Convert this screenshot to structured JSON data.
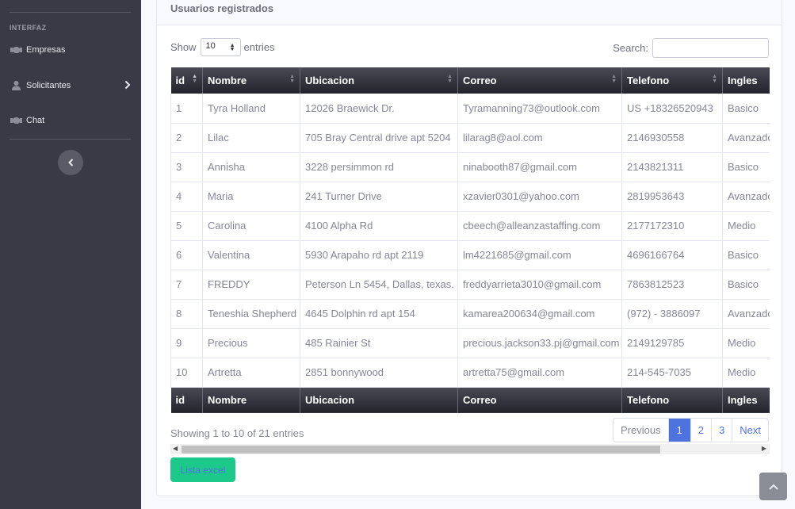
{
  "sidebar": {
    "heading": "INTERFAZ",
    "items": [
      {
        "label": "Empresas",
        "icon": "handshake-icon"
      },
      {
        "label": "Solicitantes",
        "icon": "user-icon"
      },
      {
        "label": "Chat",
        "icon": "handshake-icon"
      }
    ]
  },
  "card": {
    "title": "Usuarios registrados"
  },
  "datatable": {
    "show_label": "Show",
    "entries_label": "entries",
    "length_value": "10",
    "search_label": "Search:",
    "search_value": "",
    "columns": [
      "id",
      "Nombre",
      "Ubicacion",
      "Correo",
      "Telefono",
      "Ingles"
    ],
    "rows": [
      [
        "1",
        "Tyra Holland",
        "12026 Braewick Dr.",
        "Tyramanning73@outlook.com",
        "US +18326520943",
        "Basico"
      ],
      [
        "2",
        "Lilac",
        "705 Bray Central drive apt 5204",
        "lilarag8@aol.com",
        "2146930558",
        "Avanzado"
      ],
      [
        "3",
        "Annisha",
        "3228 persimmon rd",
        "ninabooth87@gmail.com",
        "2143821311",
        "Basico"
      ],
      [
        "4",
        "Maria",
        "241 Turner Drive",
        "xzavier0301@yahoo.com",
        "2819953643",
        "Avanzado"
      ],
      [
        "5",
        "Carolina",
        "4100 Alpha Rd",
        "cbeech@alleanzastaffing.com",
        "2177172310",
        "Medio"
      ],
      [
        "6",
        "Valentina",
        "5930 Arapaho rd apt 2119",
        "lm4221685@gmail.com",
        "4696166764",
        "Basico"
      ],
      [
        "7",
        "FREDDY",
        "Peterson Ln 5454, Dallas, texas.",
        "freddyarrieta3010@gmail.com",
        "7863812523",
        "Basico"
      ],
      [
        "8",
        "Teneshia Shepherd",
        "4645 Dolphin rd apt 154",
        "kamarea200634@gmail.com",
        "(972) - 3886097",
        "Avanzado"
      ],
      [
        "9",
        "Precious",
        "485 Rainier St",
        "precious.jackson33.pj@gmail.com",
        "2149129785",
        "Medio"
      ],
      [
        "10",
        "Artretta",
        "2851 bonnywood",
        "artretta75@gmail.com",
        "214-545-7035",
        "Medio"
      ]
    ],
    "info": "Showing 1 to 10 of 21 entries",
    "pagination": {
      "previous": "Previous",
      "pages": [
        "1",
        "2",
        "3"
      ],
      "active_page": "1",
      "next": "Next"
    }
  },
  "export_button": "Lista excel",
  "colors": {
    "sidebar": "#3a3a47",
    "primary": "#4e73df",
    "success": "#1cc88a",
    "header_dark": "#2c2c36"
  }
}
